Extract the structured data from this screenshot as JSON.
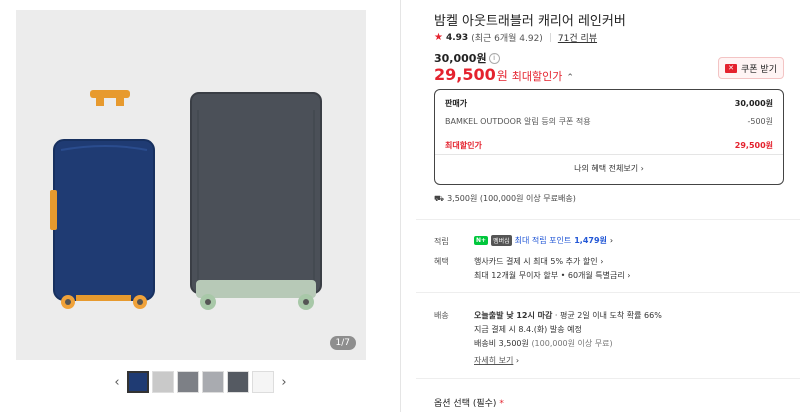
{
  "gallery": {
    "counter": "1/7",
    "thumbnail_count": 6,
    "prev_icon": "chevron-left-icon",
    "next_icon": "chevron-right-icon",
    "colors": {
      "background": "#ececec",
      "navy_cover": "#1f3b73",
      "grey_cover": "#4b5058",
      "wheel_orange": "#f0a23a",
      "wheel_mint": "#a8c8a8"
    }
  },
  "product": {
    "title": "밤켈 아웃트래블러 캐리어 레인커버",
    "rating": {
      "star_icon": "star-icon",
      "score": "4.93",
      "recent": "(최근 6개월 4.92)",
      "reviews": "71건 리뷰"
    },
    "original_price": "30,000원",
    "sale_price": {
      "amount": "29,500",
      "currency": "원",
      "label": "최대할인가"
    },
    "coupon_button": "쿠폰 받기"
  },
  "price_box": {
    "seller_label": "판매가",
    "seller_value": "30,000원",
    "discount_label": "BAMKEL OUTDOOR 알림 등의 쿠폰 적용",
    "discount_value": "-500원",
    "max_label": "최대할인가",
    "max_value": "29,500원",
    "all_benefits": "나의 혜택 전체보기"
  },
  "shipping_line": "3,500원 (100,000원 이상 무료배송)",
  "points": {
    "label": "적립",
    "badge": "N+",
    "badge2": "멤버십",
    "text": "최대 적립 포인트",
    "value": "1,479원"
  },
  "benefits": {
    "label": "혜택",
    "line1": "행사카드 결제 시 최대 5% 추가 할인",
    "line2": "최대 12개월 무이자 할부 • 60개월 특별금리"
  },
  "delivery": {
    "label": "배송",
    "line1_bold": "오늘출발 낮 12시 마감",
    "line1_rest": "· 평균 2일 이내 도착 확률 66%",
    "line2": "지금 결제 시 8.4.(화) 발송 예정",
    "line3_main": "배송비 3,500원",
    "line3_note": "(100,000원 이상 무료)",
    "detail_link": "자세히 보기"
  },
  "options": {
    "label": "옵션 선택 (필수)",
    "required_mark": "*"
  },
  "accent_red": "#e4222e"
}
